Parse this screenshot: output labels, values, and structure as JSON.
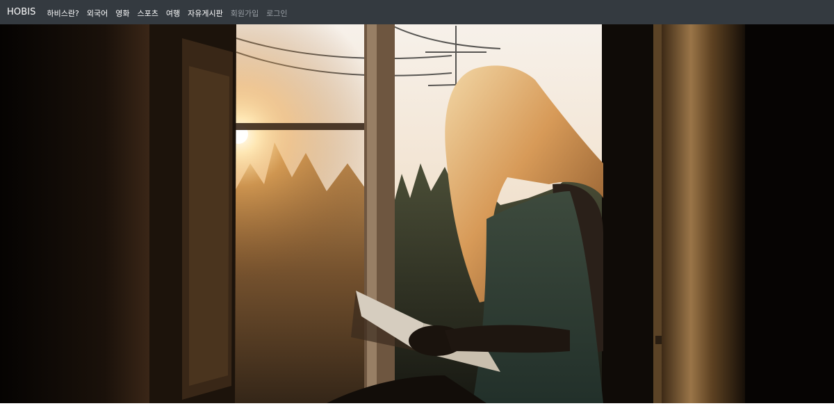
{
  "navbar": {
    "brand": "HOBIS",
    "items": [
      {
        "label": "하비스란?",
        "muted": false
      },
      {
        "label": "외국어",
        "muted": false
      },
      {
        "label": "영화",
        "muted": false
      },
      {
        "label": "스포츠",
        "muted": false
      },
      {
        "label": "여행",
        "muted": false
      },
      {
        "label": "자유게시판",
        "muted": false
      },
      {
        "label": "회원가입",
        "muted": true
      },
      {
        "label": "로그인",
        "muted": true
      }
    ]
  },
  "colors": {
    "navbar_bg": "#343a40",
    "nav_text": "#ffffff",
    "nav_text_muted": "#9aa0a6"
  },
  "hero": {
    "image": "woman-reading-book-by-window-at-sunset"
  }
}
